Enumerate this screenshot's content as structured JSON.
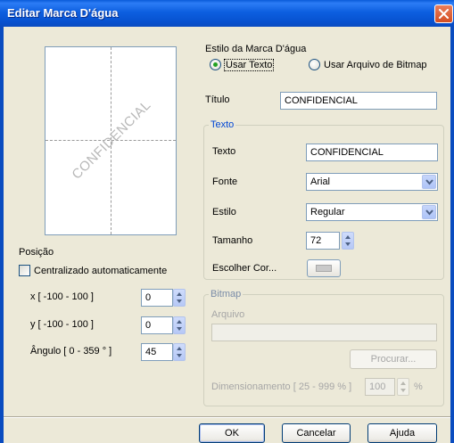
{
  "window": {
    "title": "Editar Marca D'água"
  },
  "preview": {
    "watermark_text": "CONFIDENCIAL"
  },
  "style_section": {
    "label": "Estilo da Marca D'água",
    "option_text": "Usar Texto",
    "option_bitmap": "Usar Arquivo de Bitmap",
    "selected": "Usar Texto"
  },
  "title_field": {
    "label": "Título",
    "value": "CONFIDENCIAL"
  },
  "text_group": {
    "title": "Texto",
    "text_label": "Texto",
    "text_value": "CONFIDENCIAL",
    "font_label": "Fonte",
    "font_value": "Arial",
    "style_label": "Estilo",
    "style_value": "Regular",
    "size_label": "Tamanho",
    "size_value": "72",
    "color_label": "Escolher Cor..."
  },
  "bitmap_group": {
    "title": "Bitmap",
    "file_label": "Arquivo",
    "file_value": "",
    "browse_label": "Procurar...",
    "scale_label": "Dimensionamento [ 25 - 999 % ]",
    "scale_value": "100",
    "scale_unit": "%"
  },
  "position": {
    "label": "Posição",
    "auto_center_label": "Centralizado automaticamente",
    "auto_center_checked": false,
    "x_label": "x [ -100 - 100 ]",
    "x_value": "0",
    "y_label": "y [ -100 - 100 ]",
    "y_value": "0",
    "angle_label": "Ângulo [ 0 - 359 ° ]",
    "angle_value": "45"
  },
  "buttons": {
    "ok": "OK",
    "cancel": "Cancelar",
    "help": "Ajuda"
  },
  "colors": {
    "titlebar": "#0a5bd9",
    "dialog_bg": "#ece9d8",
    "group_title": "#0046d5",
    "radio_dot": "#21a121"
  }
}
